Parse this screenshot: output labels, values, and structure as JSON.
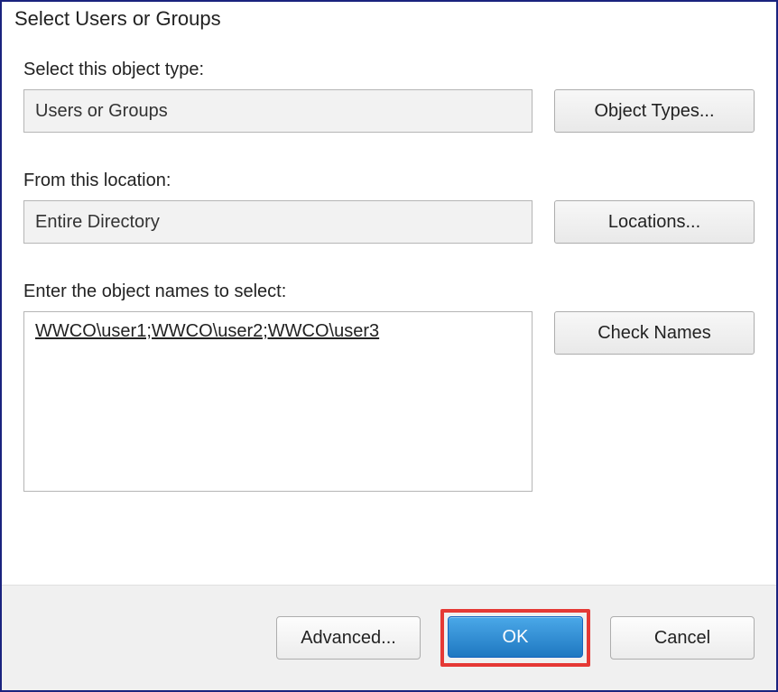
{
  "dialog": {
    "title": "Select Users or Groups",
    "object_type_label": "Select this object type:",
    "object_type_value": "Users or Groups",
    "object_types_button": "Object Types...",
    "location_label": "From this location:",
    "location_value": "Entire Directory",
    "locations_button": "Locations...",
    "names_label": "Enter the object names to select:",
    "names_value": "WWCO\\user1;WWCO\\user2;WWCO\\user3",
    "check_names_button": "Check Names"
  },
  "footer": {
    "advanced_button": "Advanced...",
    "ok_button": "OK",
    "cancel_button": "Cancel"
  }
}
